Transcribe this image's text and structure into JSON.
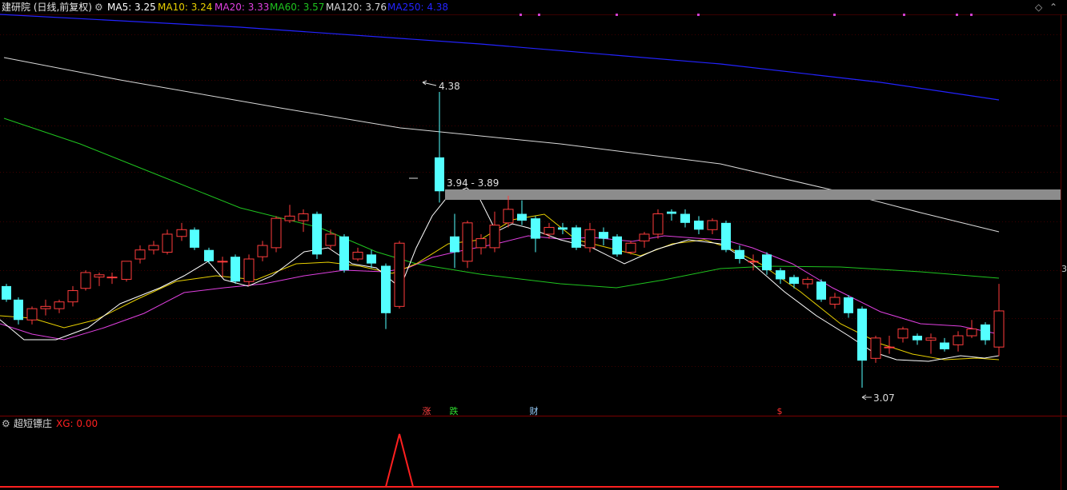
{
  "header": {
    "title": "建研院 (日线,前复权)",
    "ma5": "MA5: 3.25",
    "ma10": "MA10: 3.24",
    "ma20": "MA20: 3.33",
    "ma60": "MA60: 3.57",
    "ma120": "MA120: 3.76",
    "ma250": "MA250: 4.38",
    "settings_icon": "gear-icon",
    "diamond_icon": "diamond-icon",
    "collapse_icon": "chevron-up-icon"
  },
  "colors": {
    "up": "#ff3d3d",
    "down": "#54ffff",
    "ma5": "#ffffff",
    "ma10": "#e8d000",
    "ma20": "#e040e0",
    "ma60": "#1fc41f",
    "ma120": "#d9d9d9",
    "ma250": "#2323ff",
    "xg": "#ff2020"
  },
  "annotations": {
    "high_label": "4.38",
    "low_label": "3.07",
    "range_label": "3.94 - 3.89",
    "right_axis_label": "3"
  },
  "event_markers": [
    {
      "label": "涨",
      "color": "#ff4040"
    },
    {
      "label": "跌",
      "color": "#30e030"
    },
    {
      "label": "财",
      "color": "#9ad0ff"
    },
    {
      "label": "$",
      "color": "#ff3030"
    }
  ],
  "sub_panel": {
    "title": "超短镖庄",
    "xg_label": "XG: 0.00"
  },
  "chart_data": {
    "type": "candlestick",
    "price_high": 4.38,
    "price_low": 3.07,
    "resistance_band": [
      3.89,
      3.94
    ],
    "series": [
      {
        "name": "MA5",
        "last": 3.25
      },
      {
        "name": "MA10",
        "last": 3.24
      },
      {
        "name": "MA20",
        "last": 3.33
      },
      {
        "name": "MA60",
        "last": 3.57
      },
      {
        "name": "MA120",
        "last": 3.76
      },
      {
        "name": "MA250",
        "last": 4.38
      }
    ],
    "indicator": {
      "name": "XG",
      "last": 0.0
    }
  }
}
